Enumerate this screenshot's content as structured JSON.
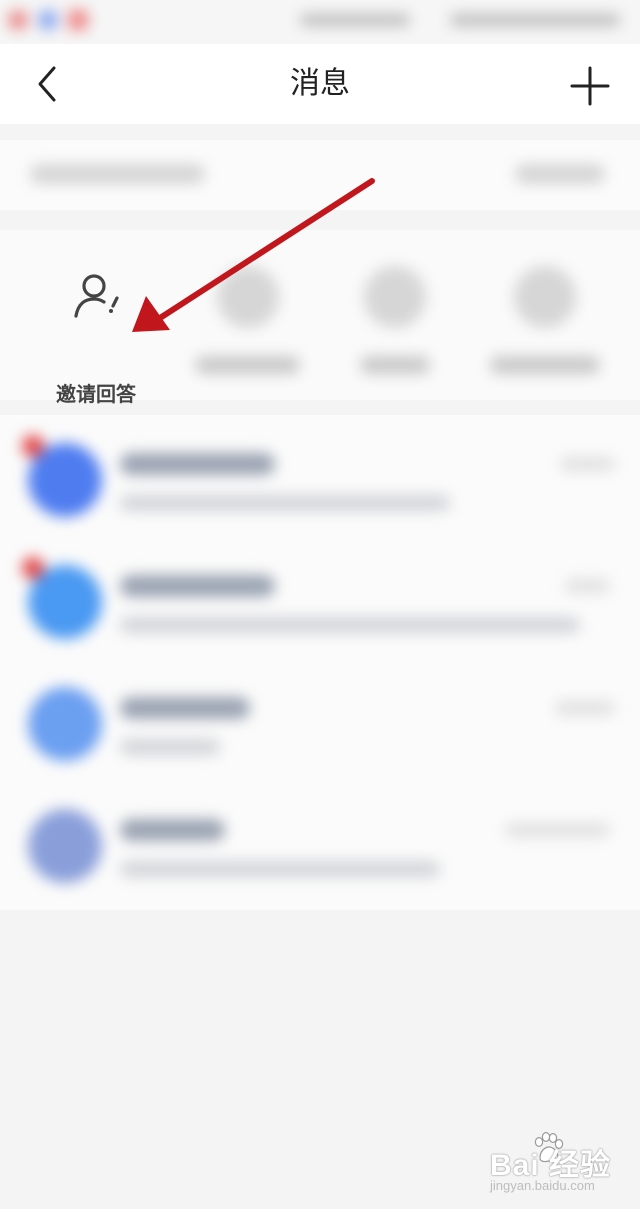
{
  "nav": {
    "title": "消息"
  },
  "quick_actions": {
    "invite_label": "邀请回答"
  },
  "watermark": {
    "brand": "Bai  经验",
    "sub": "jingyan.baidu.com"
  },
  "colors": {
    "arrow": "#c0161c",
    "icon_stroke": "#444444",
    "nav_bg": "#ffffff",
    "page_bg": "#f4f4f4"
  },
  "icons": [
    "back-chevron-icon",
    "plus-icon",
    "person-invite-icon",
    "red-arrow-annotation",
    "baidu-paw-icon"
  ]
}
